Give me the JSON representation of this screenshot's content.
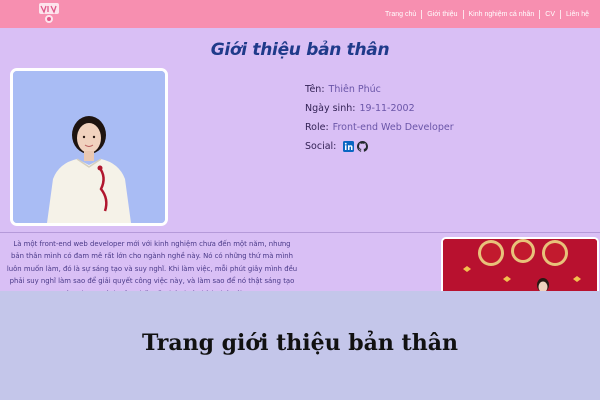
{
  "nav": {
    "links": [
      "Trang chủ",
      "Giới thiệu",
      "Kinh nghiệm cá nhân",
      "CV",
      "Liên hệ"
    ]
  },
  "page": {
    "heading": "Giới thiệu bản thân"
  },
  "profile": {
    "name_label": "Tên:",
    "name_value": "Thiên Phúc",
    "dob_label": "Ngày sinh:",
    "dob_value": "19-11-2002",
    "role_label": "Role:",
    "role_value": "Front-end Web Developer",
    "social_label": "Social:",
    "social_icons": [
      "linkedin-icon",
      "github-icon"
    ]
  },
  "about": {
    "text": "Là một front-end web developer mới với kinh nghiệm chưa đến một năm, nhưng bản thân mình có đam mê rất lớn cho ngành nghề này. Nó có những thứ mà mình luôn muốn làm, đó là sự sáng tạo và suy nghĩ. Khi làm việc, mỗi phút giây mình đều phải suy nghĩ làm sao để giải quyết công việc này, và làm sao để nó thật sáng tạo và unique! Mình cảm thấy rất thú vị và thích thú với"
  },
  "caption": {
    "text": "Trang giới thiệu bản thân"
  },
  "colors": {
    "nav_bg": "#f78fb0",
    "page_bg": "#d9bff5",
    "heading": "#1f3a8a",
    "caption_bg": "#c4c6ea",
    "linkedin": "#0a66c2"
  }
}
